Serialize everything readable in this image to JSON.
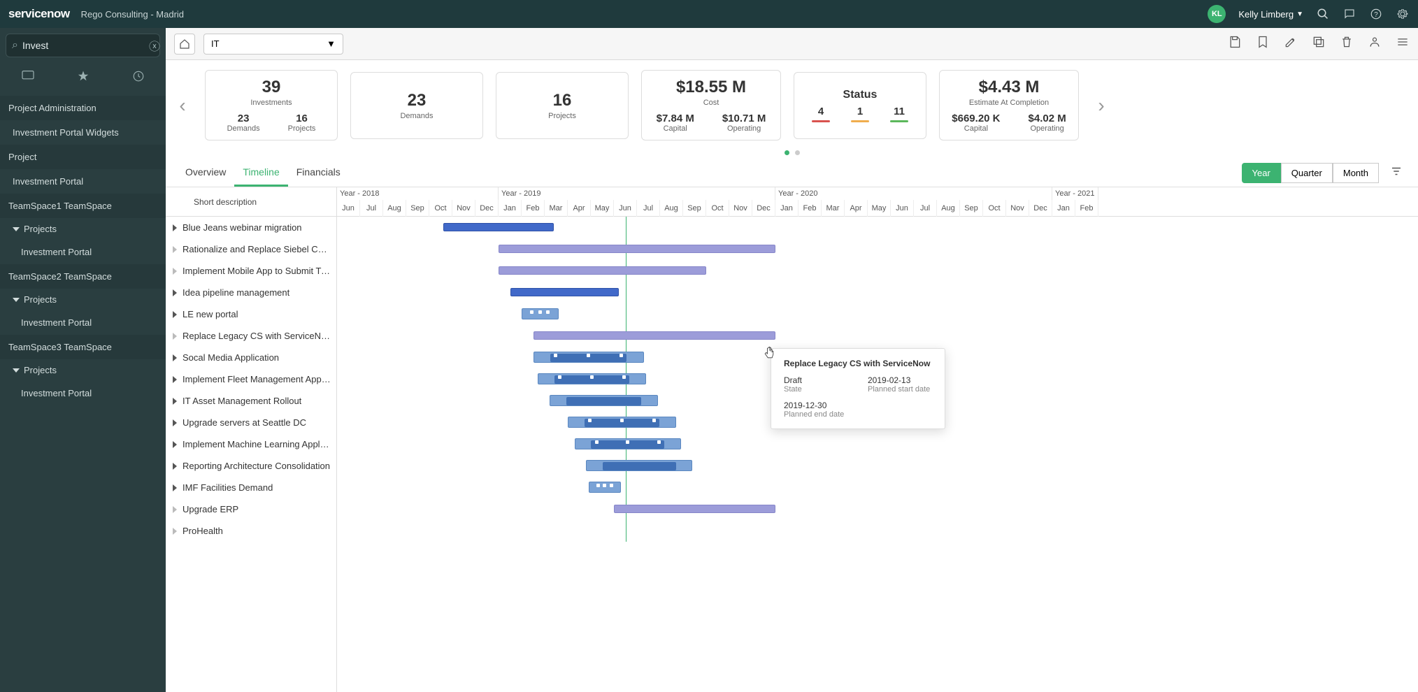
{
  "header": {
    "logo_primary": "service",
    "logo_secondary": "now",
    "instance": "Rego Consulting - Madrid",
    "avatar_initials": "KL",
    "username": "Kelly Limberg"
  },
  "sidebar": {
    "filter_value": "Invest",
    "sections": [
      {
        "title": "Project Administration",
        "items": [
          "Investment Portal Widgets"
        ]
      },
      {
        "title": "Project",
        "items": [
          "Investment Portal"
        ]
      },
      {
        "title": "TeamSpace1 TeamSpace",
        "toggle": "Projects",
        "items": [
          "Investment Portal"
        ]
      },
      {
        "title": "TeamSpace2 TeamSpace",
        "toggle": "Projects",
        "items": [
          "Investment Portal"
        ]
      },
      {
        "title": "TeamSpace3 TeamSpace",
        "toggle": "Projects",
        "items": [
          "Investment Portal"
        ]
      }
    ]
  },
  "toolbar": {
    "dropdown_value": "IT"
  },
  "kpi": {
    "card1": {
      "big": "39",
      "label": "Investments",
      "split": [
        {
          "v": "23",
          "l": "Demands"
        },
        {
          "v": "16",
          "l": "Projects"
        }
      ]
    },
    "card2": {
      "big": "23",
      "label": "Demands"
    },
    "card3": {
      "big": "16",
      "label": "Projects"
    },
    "card4": {
      "big": "$18.55 M",
      "label": "Cost",
      "split": [
        {
          "v": "$7.84 M",
          "l": "Capital"
        },
        {
          "v": "$10.71 M",
          "l": "Operating"
        }
      ]
    },
    "card5": {
      "label": "Status",
      "status": [
        {
          "v": "4",
          "c": "#d9534f"
        },
        {
          "v": "1",
          "c": "#f0ad4e"
        },
        {
          "v": "11",
          "c": "#5cb85c"
        }
      ]
    },
    "card6": {
      "big": "$4.43 M",
      "label": "Estimate At Completion",
      "split": [
        {
          "v": "$669.20 K",
          "l": "Capital"
        },
        {
          "v": "$4.02 M",
          "l": "Operating"
        }
      ]
    }
  },
  "tabs": [
    "Overview",
    "Timeline",
    "Financials"
  ],
  "active_tab": "Timeline",
  "view_buttons": [
    "Year",
    "Quarter",
    "Month"
  ],
  "active_view": "Year",
  "timeline": {
    "column_header": "Short description",
    "years": [
      {
        "label": "Year - 2018",
        "months": 7
      },
      {
        "label": "Year - 2019",
        "months": 12
      },
      {
        "label": "Year - 2020",
        "months": 12
      },
      {
        "label": "Year - 2021",
        "months": 2
      }
    ],
    "months": [
      "Jun",
      "Jul",
      "Aug",
      "Sep",
      "Oct",
      "Nov",
      "Dec",
      "Jan",
      "Feb",
      "Mar",
      "Apr",
      "May",
      "Jun",
      "Jul",
      "Aug",
      "Sep",
      "Oct",
      "Nov",
      "Dec",
      "Jan",
      "Feb",
      "Mar",
      "Apr",
      "May",
      "Jun",
      "Jul",
      "Aug",
      "Sep",
      "Oct",
      "Nov",
      "Dec",
      "Jan",
      "Feb"
    ],
    "rows": [
      {
        "label": "Blue Jeans webinar migration",
        "expandable": true,
        "bars": [
          {
            "type": "blue",
            "start": 4.6,
            "len": 4.8
          }
        ]
      },
      {
        "label": "Rationalize and Replace Siebel Customer …",
        "expandable": false,
        "bars": [
          {
            "type": "purple",
            "start": 7.0,
            "len": 12.0
          }
        ]
      },
      {
        "label": "Implement Mobile App to Submit Timesh…",
        "expandable": false,
        "bars": [
          {
            "type": "purple",
            "start": 7.0,
            "len": 9.0
          }
        ]
      },
      {
        "label": "Idea pipeline management",
        "expandable": true,
        "bars": [
          {
            "type": "blue",
            "start": 7.5,
            "len": 4.7
          }
        ]
      },
      {
        "label": "LE new portal",
        "expandable": true,
        "bars": [
          {
            "type": "light",
            "start": 8.0,
            "len": 1.6,
            "dots": true
          }
        ]
      },
      {
        "label": "Replace Legacy CS with ServiceNow",
        "expandable": false,
        "bars": [
          {
            "type": "purple",
            "start": 8.5,
            "len": 10.5
          }
        ]
      },
      {
        "label": "Socal Media Application",
        "expandable": true,
        "bars": [
          {
            "type": "light",
            "start": 8.5,
            "len": 4.8,
            "dots": true,
            "mid": true
          }
        ]
      },
      {
        "label": "Implement Fleet Management Applicat…",
        "expandable": true,
        "bars": [
          {
            "type": "light",
            "start": 8.7,
            "len": 4.7,
            "dots": true,
            "mid": true
          }
        ]
      },
      {
        "label": "IT Asset Management Rollout",
        "expandable": true,
        "bars": [
          {
            "type": "light",
            "start": 9.2,
            "len": 4.7,
            "mid": true
          }
        ]
      },
      {
        "label": "Upgrade servers at Seattle DC",
        "expandable": true,
        "bars": [
          {
            "type": "light",
            "start": 10.0,
            "len": 4.7,
            "dots": true,
            "mid": true
          }
        ]
      },
      {
        "label": "Implement Machine Learning Application",
        "expandable": true,
        "bars": [
          {
            "type": "light",
            "start": 10.3,
            "len": 4.6,
            "dots": true,
            "mid": true
          }
        ]
      },
      {
        "label": "Reporting Architecture Consolidation",
        "expandable": true,
        "bars": [
          {
            "type": "light",
            "start": 10.8,
            "len": 4.6,
            "mid": true
          }
        ]
      },
      {
        "label": "IMF Facilities Demand",
        "expandable": true,
        "bars": [
          {
            "type": "light",
            "start": 10.9,
            "len": 1.4,
            "dots": true
          }
        ]
      },
      {
        "label": "Upgrade ERP",
        "expandable": false,
        "bars": [
          {
            "type": "purple",
            "start": 12.0,
            "len": 7.0
          }
        ]
      },
      {
        "label": "ProHealth",
        "expandable": false,
        "bars": []
      }
    ]
  },
  "tooltip": {
    "title": "Replace Legacy CS with ServiceNow",
    "state_val": "Draft",
    "state_lbl": "State",
    "start_val": "2019-02-13",
    "start_lbl": "Planned start date",
    "end_val": "2019-12-30",
    "end_lbl": "Planned end date"
  }
}
